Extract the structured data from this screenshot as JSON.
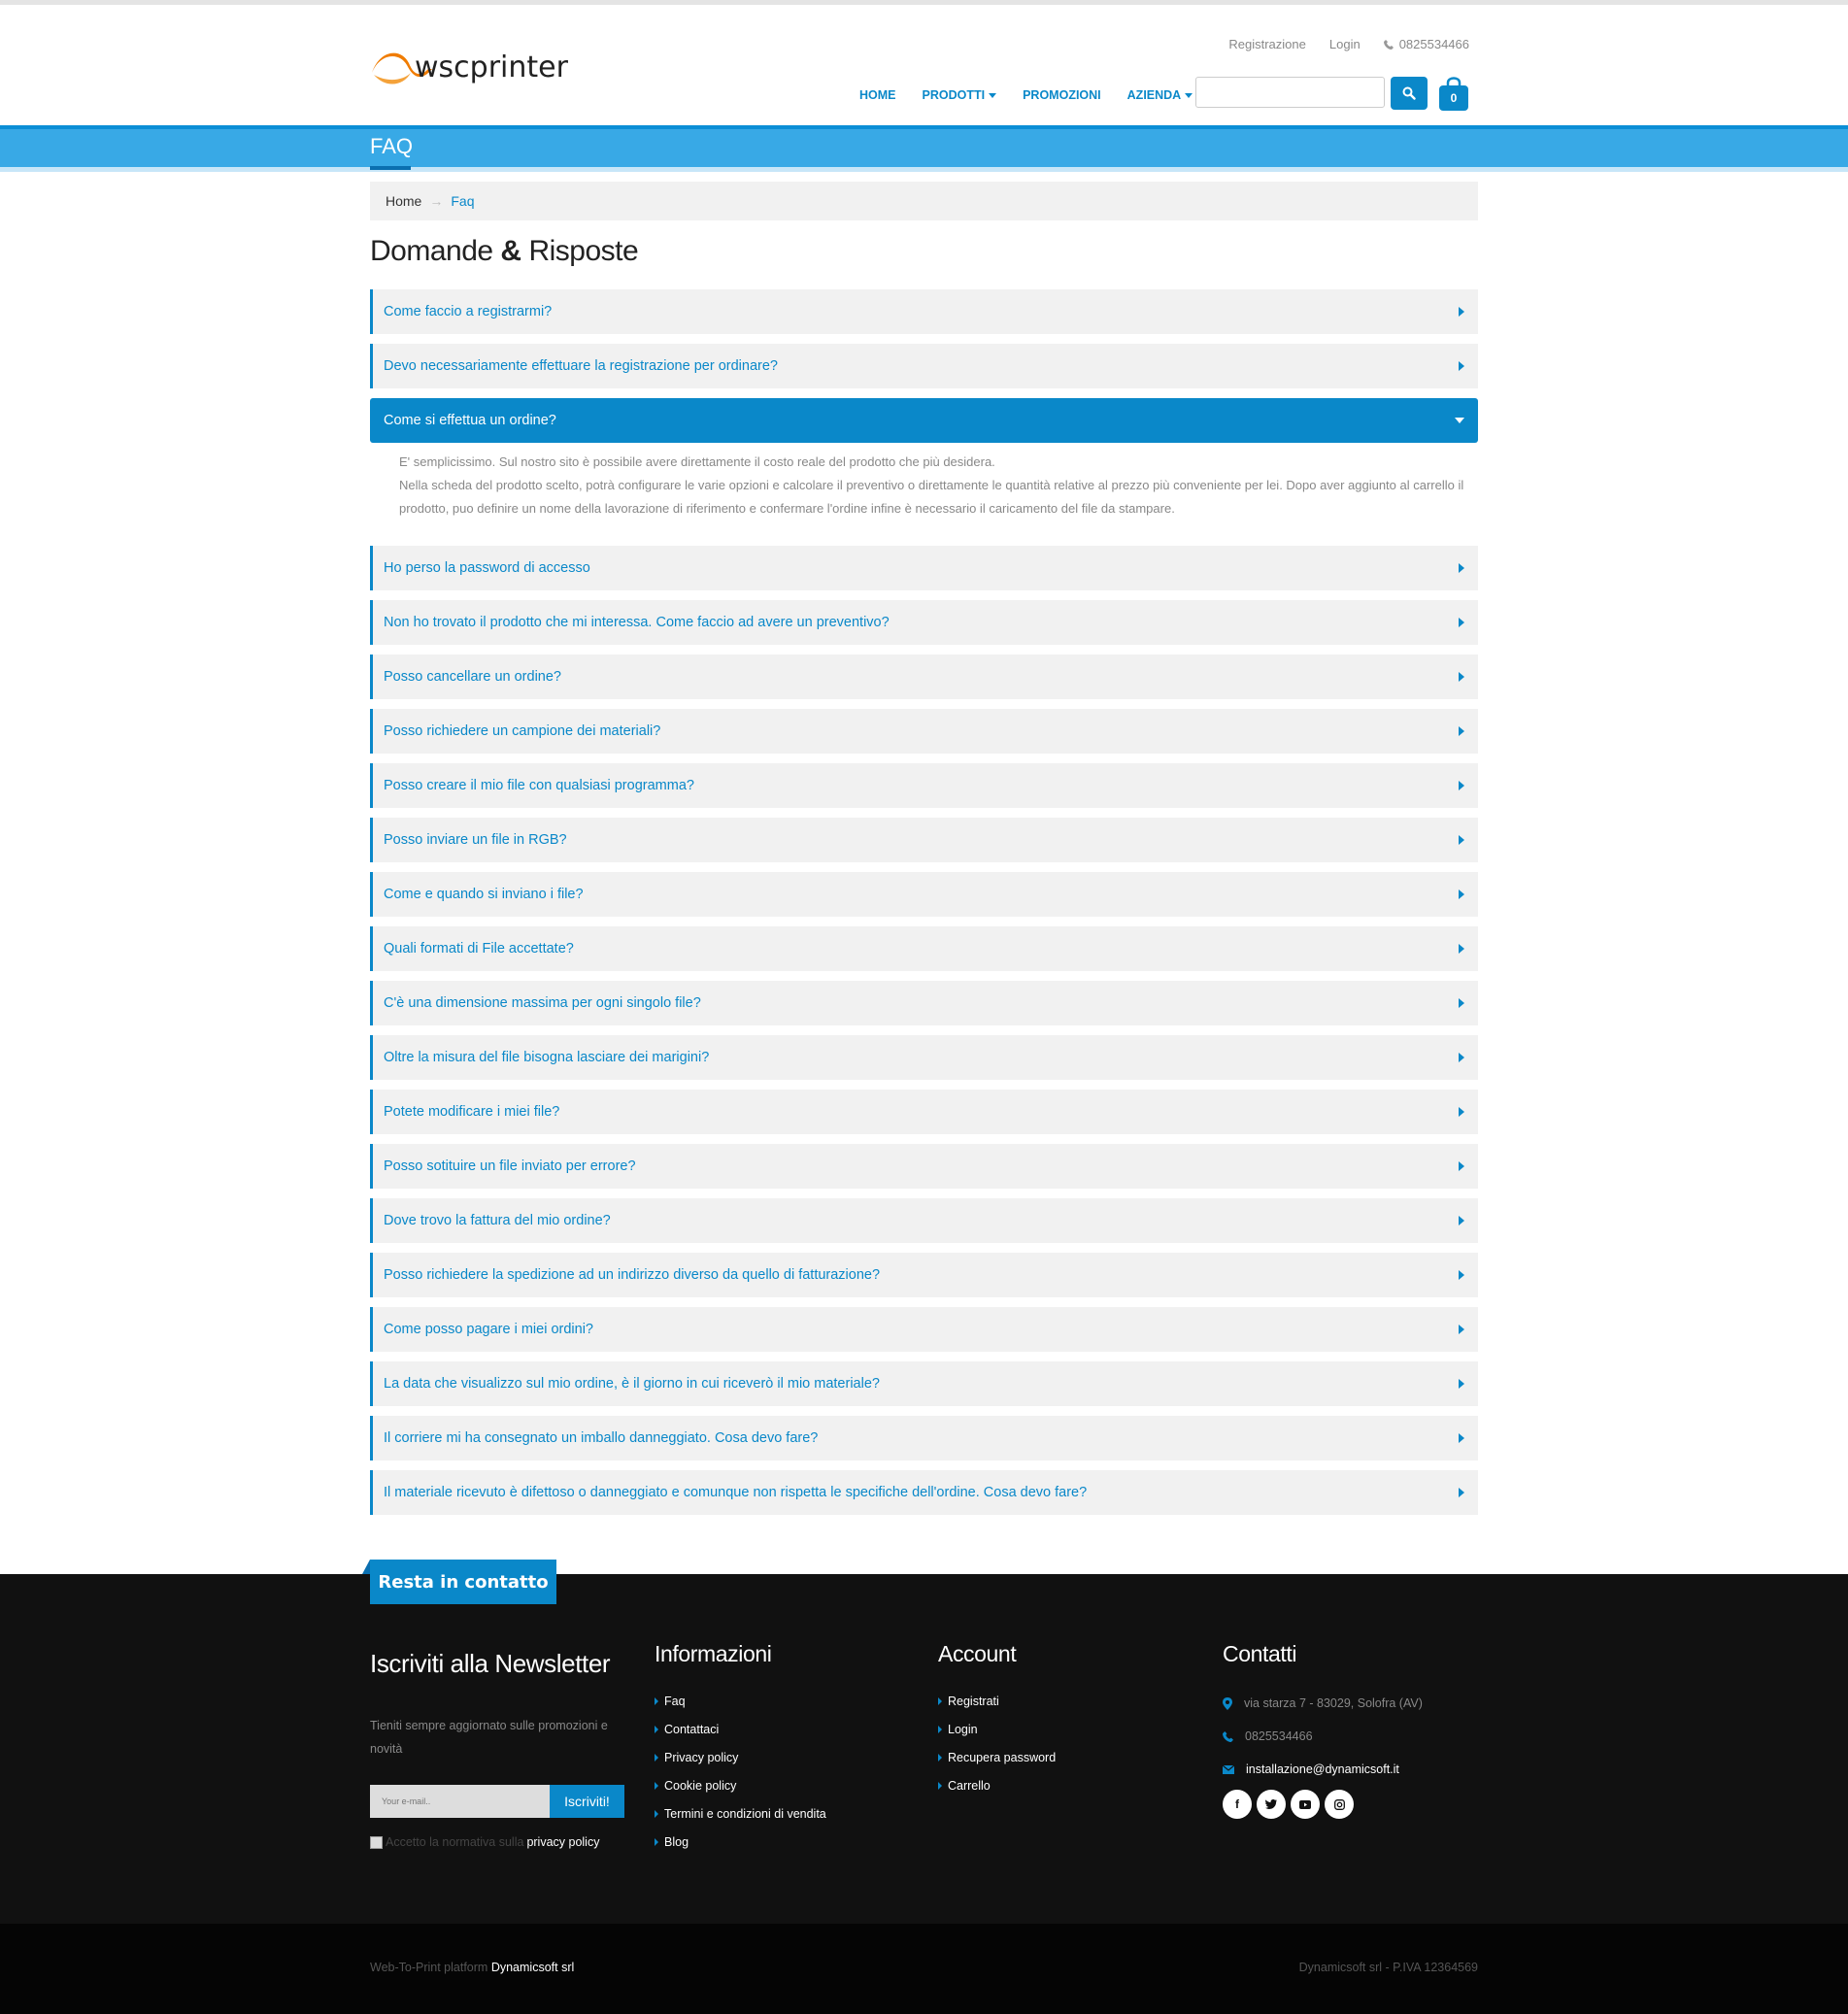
{
  "header": {
    "logo_text": "wscprinter",
    "top_links": {
      "register": "Registrazione",
      "login": "Login",
      "phone": "0825534466"
    },
    "nav": [
      {
        "label": "HOME"
      },
      {
        "label": "PRODOTTI"
      },
      {
        "label": "PROMOZIONI"
      },
      {
        "label": "AZIENDA"
      }
    ],
    "search": {
      "value": "",
      "placeholder": ""
    },
    "cart_count": "0",
    "colors": {
      "accent": "#0a88c9",
      "banner": "#38a9e6"
    }
  },
  "banner": {
    "title": "FAQ"
  },
  "breadcrumb": {
    "home": "Home",
    "current": "Faq"
  },
  "page_title": {
    "part1": "Domande",
    "amp": "&",
    "part2": "Risposte"
  },
  "faq": {
    "q1": "Come faccio a registrarmi?",
    "q2": "Devo necessariamente effettuare la registrazione per ordinare?",
    "q3": "Come si effettua un ordine?",
    "a3_line1": "E' semplicissimo. Sul nostro sito è possibile avere direttamente il costo reale del prodotto che più desidera.",
    "a3_line2": "Nella scheda del prodotto scelto,  potrà configurare le varie opzioni e calcolare il preventivo o direttamente le quantità relative al prezzo più conveniente per lei. Dopo aver aggiunto al carrello il prodotto, puo definire un nome della lavorazione di riferimento e confermare l'ordine infine è necessario il caricamento del file da stampare.",
    "q4": "Ho perso la password di accesso",
    "q5": "Non ho trovato il prodotto che mi interessa. Come faccio ad avere un preventivo?",
    "q6": "Posso cancellare un ordine?",
    "q7": "Posso richiedere un campione dei materiali?",
    "q8": "Posso creare il mio file con qualsiasi programma?",
    "q9": "Posso inviare un file in RGB?",
    "q10": "Come e quando si inviano i file?",
    "q11": "Quali formati di File accettate?",
    "q12": "C'è una dimensione massima per ogni singolo file?",
    "q13": "Oltre la misura del file bisogna lasciare dei marigini?",
    "q14": "Potete modificare i miei file?",
    "q15": "Posso sotituire un file inviato per errore?",
    "q16": "Dove trovo la fattura del mio ordine?",
    "q17": "Posso richiedere la spedizione ad un indirizzo diverso da quello di fatturazione?",
    "q18": "Come posso pagare i miei ordini?",
    "q19": "La data che visualizzo sul mio ordine, è il giorno in cui riceverò il mio materiale?",
    "q20": "Il corriere mi ha consegnato un imballo danneggiato. Cosa devo fare?",
    "q21": "Il materiale ricevuto è difettoso o danneggiato e comunque non rispetta le specifiche dell'ordine. Cosa devo fare?"
  },
  "footer": {
    "tab": "Resta in contatto",
    "newsletter": {
      "title": "Iscriviti alla Newsletter",
      "desc": "Tieniti sempre aggiornato sulle promozioni e novità",
      "placeholder": "Your e-mail..",
      "button": "Iscriviti!",
      "accept": "Accetto la normativa sulla",
      "privacy": "privacy policy"
    },
    "info": {
      "title": "Informazioni",
      "items": [
        "Faq",
        "Contattaci",
        "Privacy policy",
        "Cookie policy",
        "Termini e condizioni di vendita",
        "Blog"
      ]
    },
    "account": {
      "title": "Account",
      "items": [
        "Registrati",
        "Login",
        "Recupera password",
        "Carrello"
      ]
    },
    "contacts": {
      "title": "Contatti",
      "address": "via starza 7 - 83029, Solofra (AV)",
      "phone": "0825534466",
      "email": "installazione@dynamicsoft.it",
      "social": [
        "facebook-icon",
        "twitter-icon",
        "youtube-icon",
        "instagram-icon"
      ]
    },
    "bottom": {
      "left_prefix": "Web-To-Print platform",
      "left_brand": "Dynamicsoft srl",
      "right": "Dynamicsoft srl - P.IVA 12364569"
    }
  }
}
